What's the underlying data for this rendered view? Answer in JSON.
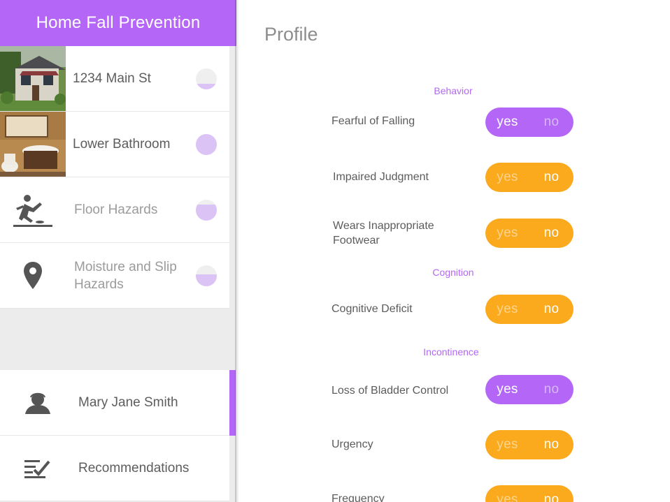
{
  "app": {
    "title": "Home Fall Prevention"
  },
  "rooms": [
    {
      "label": "1234 Main St",
      "progress": 0.25,
      "thumb": "house-photo"
    },
    {
      "label": "Lower Bathroom",
      "progress": 1.0,
      "thumb": "bathroom-photo"
    },
    {
      "label": "Floor Hazards",
      "progress": 0.75,
      "icon": "slip-fall-icon"
    },
    {
      "label": "Moisture and Slip Hazards",
      "progress": 0.55,
      "icon": "location-pin-icon"
    }
  ],
  "users": [
    {
      "label": "Mary Jane Smith",
      "icon": "person-icon",
      "active": true
    },
    {
      "label": "Recommendations",
      "icon": "checklist-icon",
      "active": false
    }
  ],
  "profile": {
    "title": "Profile",
    "sections": [
      {
        "title": "Behavior",
        "questions": [
          {
            "label": "Fearful of Falling",
            "answer": "yes"
          },
          {
            "label": "Impaired Judgment",
            "answer": "no"
          },
          {
            "label": "Wears Inappropriate Footwear",
            "answer": "no"
          }
        ]
      },
      {
        "title": "Cognition",
        "questions": [
          {
            "label": "Cognitive Deficit",
            "answer": "no"
          }
        ]
      },
      {
        "title": "Incontinence",
        "questions": [
          {
            "label": "Loss of Bladder Control",
            "answer": "yes"
          },
          {
            "label": "Urgency",
            "answer": "no"
          },
          {
            "label": "Frequency",
            "answer": "no"
          }
        ]
      }
    ],
    "toggle_labels": {
      "yes": "yes",
      "no": "no"
    }
  },
  "colors": {
    "accent": "#b467f7",
    "answer_no": "#fbaa1e",
    "progress": "#dcc3f6"
  }
}
